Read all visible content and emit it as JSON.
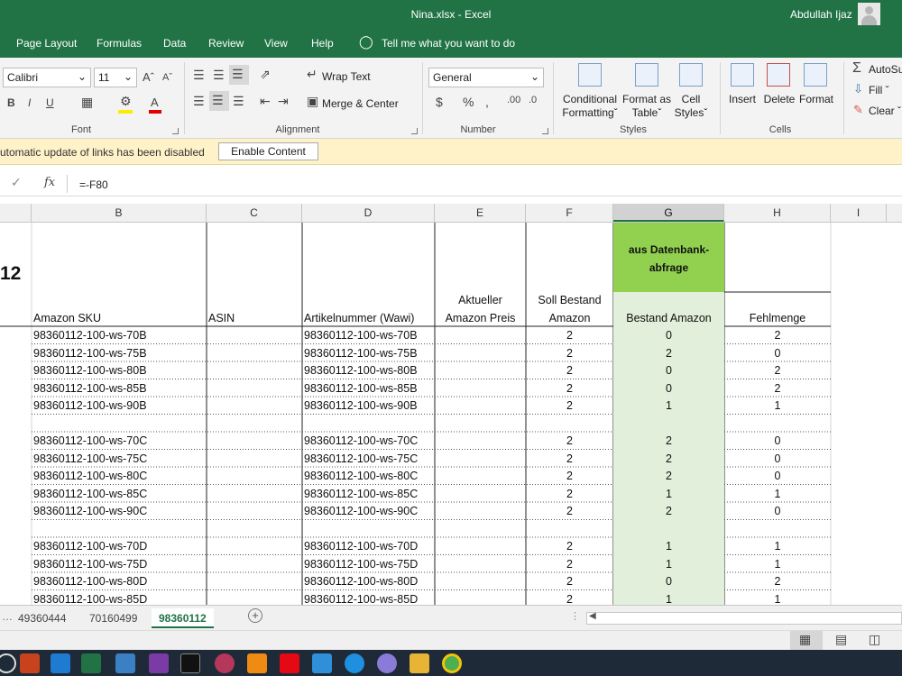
{
  "window": {
    "title": "Nina.xlsx  -  Excel",
    "user": "Abdullah Ijaz"
  },
  "tabs": [
    "Page Layout",
    "Formulas",
    "Data",
    "Review",
    "View",
    "Help"
  ],
  "tell_me": "Tell me what you want to do",
  "ribbon": {
    "font": {
      "name": "Calibri",
      "size": "11",
      "label": "Font"
    },
    "alignment": {
      "wrap_text": "Wrap Text",
      "merge_center": "Merge & Center",
      "label": "Alignment"
    },
    "number": {
      "format": "General",
      "label": "Number"
    },
    "styles": {
      "conditional_1": "Conditional",
      "conditional_2": "Formatting",
      "format_as_1": "Format as",
      "format_as_2": "Table",
      "cell_styles_1": "Cell",
      "cell_styles_2": "Styles",
      "label": "Styles"
    },
    "cells": {
      "insert": "Insert",
      "delete": "Delete",
      "format": "Format",
      "label": "Cells"
    },
    "editing": {
      "autosum": "AutoSu",
      "fill": "Fill",
      "clear": "Clear"
    }
  },
  "message_bar": {
    "text": "utomatic update of links has been disabled",
    "button": "Enable Content"
  },
  "formula_bar": {
    "fx": "fx",
    "formula": "=-F80"
  },
  "columns": [
    "B",
    "C",
    "D",
    "E",
    "F",
    "G",
    "H",
    "I"
  ],
  "selected_column": "G",
  "sheet": {
    "title_fragment": "12",
    "g_header": "aus Datenbank-\nabfrage",
    "headers": {
      "B": "Amazon SKU",
      "C": "ASIN",
      "D": "Artikelnummer (Wawi)",
      "E1": "Aktueller",
      "E2": "Amazon Preis",
      "F1": "Soll Bestand",
      "F2": "Amazon",
      "G": "Bestand Amazon",
      "H": "Fehlmenge"
    },
    "rows": [
      {
        "sku": "98360112-100-ws-70B",
        "art": "98360112-100-ws-70B",
        "soll": "2",
        "bestand": "0",
        "fehl": "2"
      },
      {
        "sku": "98360112-100-ws-75B",
        "art": "98360112-100-ws-75B",
        "soll": "2",
        "bestand": "2",
        "fehl": "0"
      },
      {
        "sku": "98360112-100-ws-80B",
        "art": "98360112-100-ws-80B",
        "soll": "2",
        "bestand": "0",
        "fehl": "2"
      },
      {
        "sku": "98360112-100-ws-85B",
        "art": "98360112-100-ws-85B",
        "soll": "2",
        "bestand": "0",
        "fehl": "2"
      },
      {
        "sku": "98360112-100-ws-90B",
        "art": "98360112-100-ws-90B",
        "soll": "2",
        "bestand": "1",
        "fehl": "1"
      },
      {
        "sku": "",
        "art": "",
        "soll": "",
        "bestand": "",
        "fehl": ""
      },
      {
        "sku": "98360112-100-ws-70C",
        "art": "98360112-100-ws-70C",
        "soll": "2",
        "bestand": "2",
        "fehl": "0"
      },
      {
        "sku": "98360112-100-ws-75C",
        "art": "98360112-100-ws-75C",
        "soll": "2",
        "bestand": "2",
        "fehl": "0"
      },
      {
        "sku": "98360112-100-ws-80C",
        "art": "98360112-100-ws-80C",
        "soll": "2",
        "bestand": "2",
        "fehl": "0"
      },
      {
        "sku": "98360112-100-ws-85C",
        "art": "98360112-100-ws-85C",
        "soll": "2",
        "bestand": "1",
        "fehl": "1"
      },
      {
        "sku": "98360112-100-ws-90C",
        "art": "98360112-100-ws-90C",
        "soll": "2",
        "bestand": "2",
        "fehl": "0"
      },
      {
        "sku": "",
        "art": "",
        "soll": "",
        "bestand": "",
        "fehl": ""
      },
      {
        "sku": "98360112-100-ws-70D",
        "art": "98360112-100-ws-70D",
        "soll": "2",
        "bestand": "1",
        "fehl": "1"
      },
      {
        "sku": "98360112-100-ws-75D",
        "art": "98360112-100-ws-75D",
        "soll": "2",
        "bestand": "1",
        "fehl": "1"
      },
      {
        "sku": "98360112-100-ws-80D",
        "art": "98360112-100-ws-80D",
        "soll": "2",
        "bestand": "0",
        "fehl": "2"
      },
      {
        "sku": "98360112-100-ws-85D",
        "art": "98360112-100-ws-85D",
        "soll": "2",
        "bestand": "1",
        "fehl": "1"
      }
    ]
  },
  "sheet_tabs": [
    "49360444",
    "70160499",
    "98360112"
  ],
  "active_sheet": "98360112",
  "colors": {
    "excel_green": "#217346",
    "highlight_green": "#92d050",
    "light_green": "#e2efda"
  }
}
